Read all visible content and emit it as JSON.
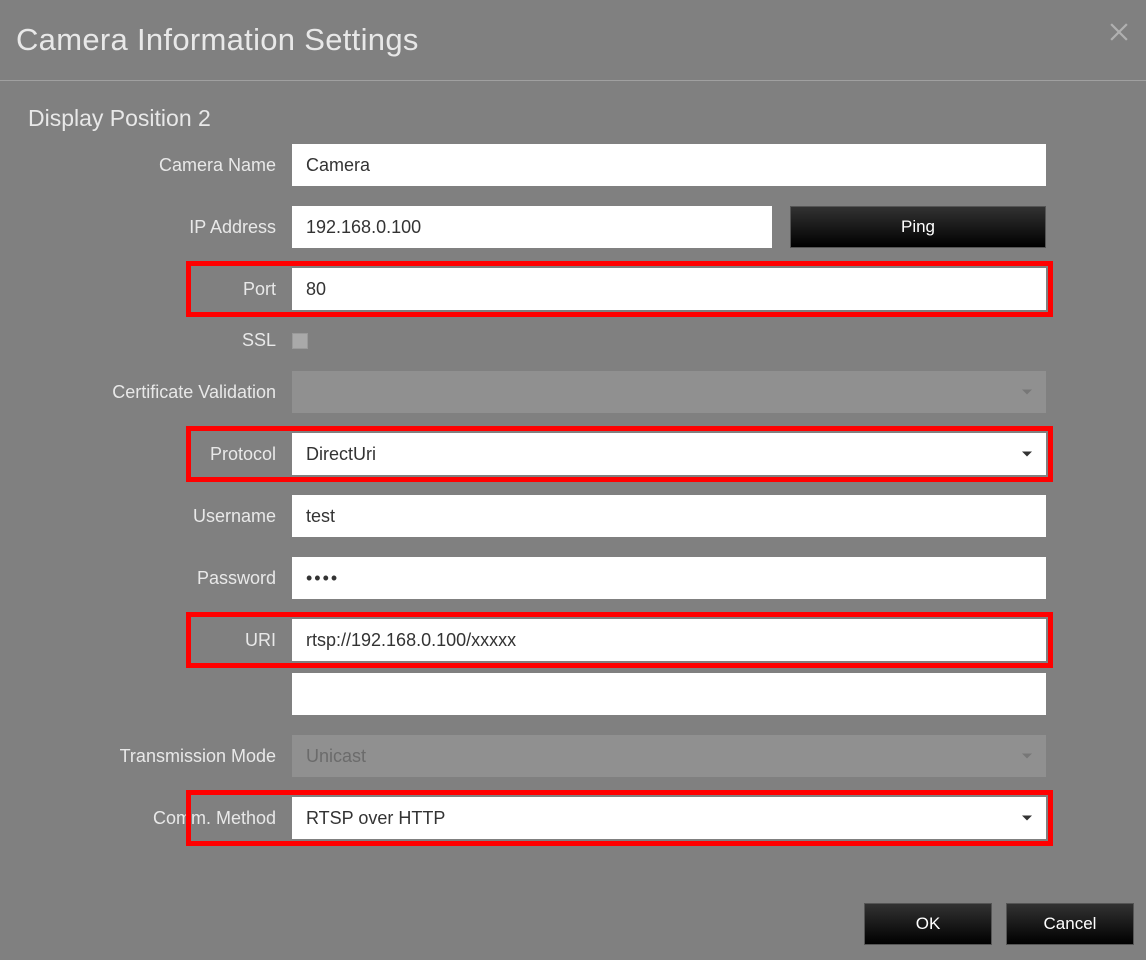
{
  "header": {
    "title": "Camera Information Settings"
  },
  "section_title": "Display Position 2",
  "labels": {
    "camera_name": "Camera Name",
    "ip_address": "IP Address",
    "port": "Port",
    "ssl": "SSL",
    "cert_validation": "Certificate Validation",
    "protocol": "Protocol",
    "username": "Username",
    "password": "Password",
    "uri": "URI",
    "transmission_mode": "Transmission Mode",
    "comm_method": "Comm. Method"
  },
  "values": {
    "camera_name": "Camera",
    "ip_address": "192.168.0.100",
    "port": "80",
    "ssl_checked": false,
    "cert_validation": "",
    "protocol": "DirectUri",
    "username": "test",
    "password": "••••",
    "uri": "rtsp://192.168.0.100/xxxxx",
    "transmission_mode": "Unicast",
    "comm_method": "RTSP over HTTP"
  },
  "buttons": {
    "ping": "Ping",
    "ok": "OK",
    "cancel": "Cancel"
  }
}
